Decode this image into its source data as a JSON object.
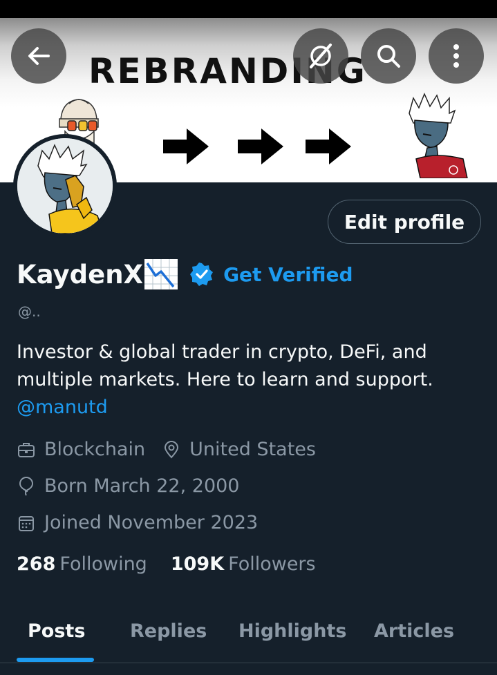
{
  "banner": {
    "title": "REBRANDING"
  },
  "header_buttons": {
    "back_icon": "arrow-left-icon",
    "grok_icon": "slash-circle-icon",
    "search_icon": "search-icon",
    "more_icon": "more-vertical-icon"
  },
  "profile": {
    "display_name": "KaydenX",
    "name_emoji": "chart-decreasing-emoji",
    "get_verified": "Get Verified",
    "handle": "@..",
    "edit_profile": "Edit profile",
    "bio_text": "Investor & global trader in crypto, DeFi, and multiple markets. Here to learn and support.",
    "bio_mention": "@manutd",
    "category": "Blockchain",
    "location": "United States",
    "born": "Born March 22, 2000",
    "joined": "Joined November 2023"
  },
  "stats": {
    "following_count": "268",
    "following_label": "Following",
    "followers_count": "109K",
    "followers_label": "Followers"
  },
  "tabs": [
    {
      "label": "Posts",
      "active": true
    },
    {
      "label": "Replies",
      "active": false
    },
    {
      "label": "Highlights",
      "active": false
    },
    {
      "label": "Articles",
      "active": false
    },
    {
      "label": "",
      "active": false
    }
  ],
  "colors": {
    "background": "#15202b",
    "accent": "#1d9bf0",
    "muted": "#8b98a5"
  }
}
